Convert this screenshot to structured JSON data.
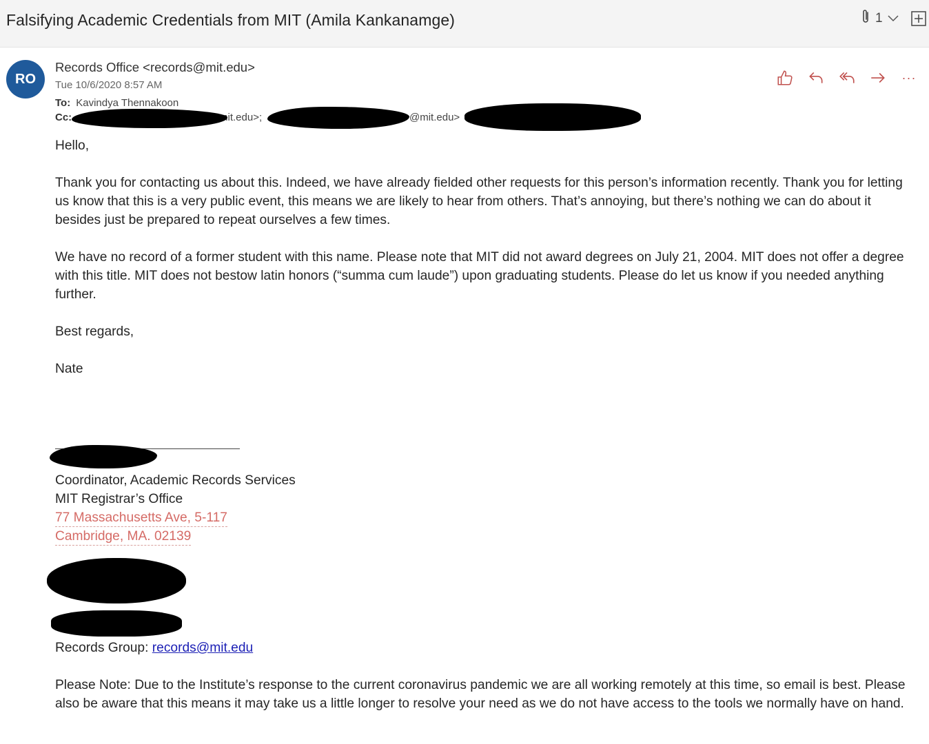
{
  "email": {
    "subject": "Falsifying Academic Credentials from MIT (Amila Kankanamge)",
    "attachment_count": "1",
    "avatar_initials": "RO",
    "sender": "Records Office <records@mit.edu>",
    "date": "Tue 10/6/2020 8:57 AM",
    "to_label": "To:",
    "to_value": "Kavindya Thennakoon",
    "cc_label": "Cc:",
    "cc_fragment_1": "mit.edu>;",
    "cc_fragment_2": "@mit.edu>",
    "actions": [
      "thumbs-up",
      "reply",
      "reply-all",
      "forward",
      "more"
    ],
    "more_label": "···"
  },
  "body": {
    "greeting": "Hello,",
    "paragraph_1": "Thank you for contacting us about this. Indeed, we have already fielded other requests for this person’s information recently. Thank you for letting us know that this is a very public event, this means we are likely to hear from others. That’s annoying, but there’s nothing we can do about it besides just be prepared to repeat ourselves a few times.",
    "paragraph_2": "We have no record of a former student with this name. Please note that MIT did not award degrees on July 21, 2004. MIT does not offer a degree with this title. MIT does not bestow latin honors (“summa cum laude”) upon graduating students. Please do let us know if you needed anything further.",
    "closing": "Best regards,",
    "name": "Nate"
  },
  "signature": {
    "title": "Coordinator, Academic Records Services",
    "office": "MIT Registrar’s Office",
    "address_1": "77 Massachusetts Ave, 5-117",
    "address_2": "Cambridge, MA. 02139",
    "records_label": "Records Group: ",
    "records_email": "records@mit.edu",
    "note": "Please Note: Due to the Institute’s response to the current coronavirus pandemic we are all working remotely at this time, so email is best. Please also be aware that this means it may take us a little longer to resolve your need as we do not have access to the tools we normally have on hand."
  },
  "colors": {
    "avatar_bg": "#1f5a9b",
    "action_icon": "#c0504d",
    "address_text": "#d56b66",
    "link": "#1b1fb5"
  }
}
